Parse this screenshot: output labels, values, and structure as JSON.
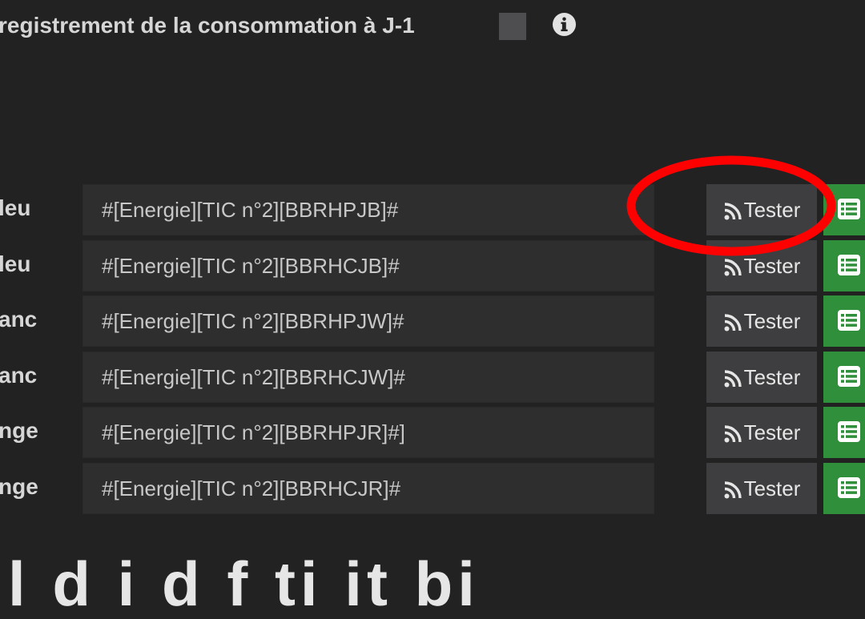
{
  "header": {
    "label": "registrement de la consommation à J-1",
    "checkbox_checked": false,
    "info_icon": "info-circle-icon"
  },
  "commands": [
    {
      "label": "leu",
      "value": "#[Energie][TIC n°2][BBRHPJB]#",
      "test_label": "Tester"
    },
    {
      "label": "leu",
      "value": "#[Energie][TIC n°2][BBRHCJB]#",
      "test_label": "Tester"
    },
    {
      "label": "anc",
      "value": "#[Energie][TIC n°2][BBRHPJW]#",
      "test_label": "Tester"
    },
    {
      "label": "anc",
      "value": "#[Energie][TIC n°2][BBRHCJW]#",
      "test_label": "Tester"
    },
    {
      "label": "nge",
      "value": "#[Energie][TIC n°2][BBRHPJR]#]",
      "test_label": "Tester"
    },
    {
      "label": "nge",
      "value": "#[Energie][TIC n°2][BBRHCJR]#",
      "test_label": "Tester"
    }
  ],
  "icons": {
    "test_button": "rss-icon",
    "green_button": "list-icon"
  },
  "colors": {
    "background": "#222222",
    "input_background": "#2e2e2e",
    "test_button": "#3e3e40",
    "list_button": "#2f8f3b",
    "annotation": "#ff0000"
  },
  "bottom": {
    "text": "l d i d f ti it bi"
  }
}
